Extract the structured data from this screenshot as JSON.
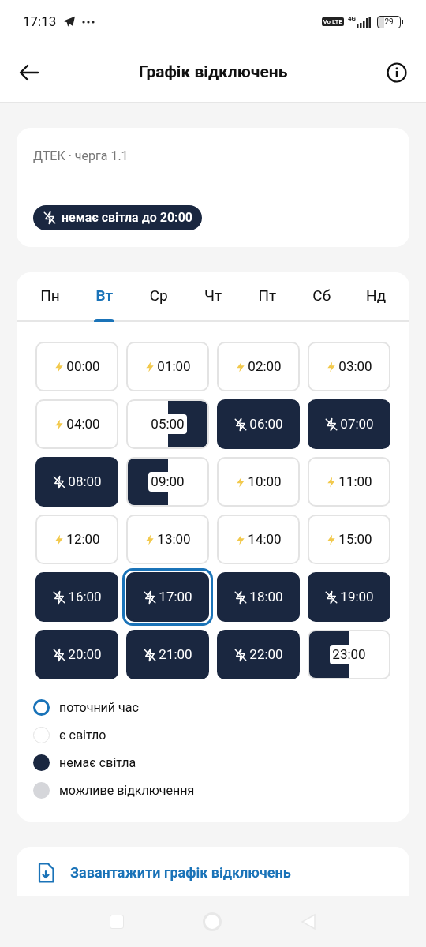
{
  "status_bar": {
    "time": "17:13",
    "volte": "Vo LTE",
    "network": "4G",
    "battery": "29"
  },
  "header": {
    "title": "Графік відключень"
  },
  "summary": {
    "subtitle": "ДТЕК · черга 1.1",
    "badge": "немає світла до 20:00"
  },
  "tabs": [
    {
      "label": "Пн",
      "selected": false
    },
    {
      "label": "Вт",
      "selected": true
    },
    {
      "label": "Ср",
      "selected": false
    },
    {
      "label": "Чт",
      "selected": false
    },
    {
      "label": "Пт",
      "selected": false
    },
    {
      "label": "Сб",
      "selected": false
    },
    {
      "label": "Нд",
      "selected": false
    }
  ],
  "slots": [
    {
      "time": "00:00",
      "kind": "on",
      "current": false
    },
    {
      "time": "01:00",
      "kind": "on",
      "current": false
    },
    {
      "time": "02:00",
      "kind": "on",
      "current": false
    },
    {
      "time": "03:00",
      "kind": "on",
      "current": false
    },
    {
      "time": "04:00",
      "kind": "on",
      "current": false
    },
    {
      "time": "05:00",
      "kind": "second_half_off",
      "current": false
    },
    {
      "time": "06:00",
      "kind": "off",
      "current": false
    },
    {
      "time": "07:00",
      "kind": "off",
      "current": false
    },
    {
      "time": "08:00",
      "kind": "off",
      "current": false
    },
    {
      "time": "09:00",
      "kind": "first_half_off",
      "current": false
    },
    {
      "time": "10:00",
      "kind": "on",
      "current": false
    },
    {
      "time": "11:00",
      "kind": "on",
      "current": false
    },
    {
      "time": "12:00",
      "kind": "on",
      "current": false
    },
    {
      "time": "13:00",
      "kind": "on",
      "current": false
    },
    {
      "time": "14:00",
      "kind": "on",
      "current": false
    },
    {
      "time": "15:00",
      "kind": "on",
      "current": false
    },
    {
      "time": "16:00",
      "kind": "off",
      "current": false
    },
    {
      "time": "17:00",
      "kind": "off",
      "current": true
    },
    {
      "time": "18:00",
      "kind": "off",
      "current": false
    },
    {
      "time": "19:00",
      "kind": "off",
      "current": false
    },
    {
      "time": "20:00",
      "kind": "off",
      "current": false
    },
    {
      "time": "21:00",
      "kind": "off",
      "current": false
    },
    {
      "time": "22:00",
      "kind": "off",
      "current": false
    },
    {
      "time": "23:00",
      "kind": "first_half_off",
      "current": false
    }
  ],
  "legend": [
    {
      "kind": "current",
      "label": "поточний час"
    },
    {
      "kind": "on",
      "label": "є світло"
    },
    {
      "kind": "off",
      "label": "немає світла"
    },
    {
      "kind": "possible",
      "label": "можливе відключення"
    }
  ],
  "download": {
    "label": "Завантажити графік відключень"
  }
}
